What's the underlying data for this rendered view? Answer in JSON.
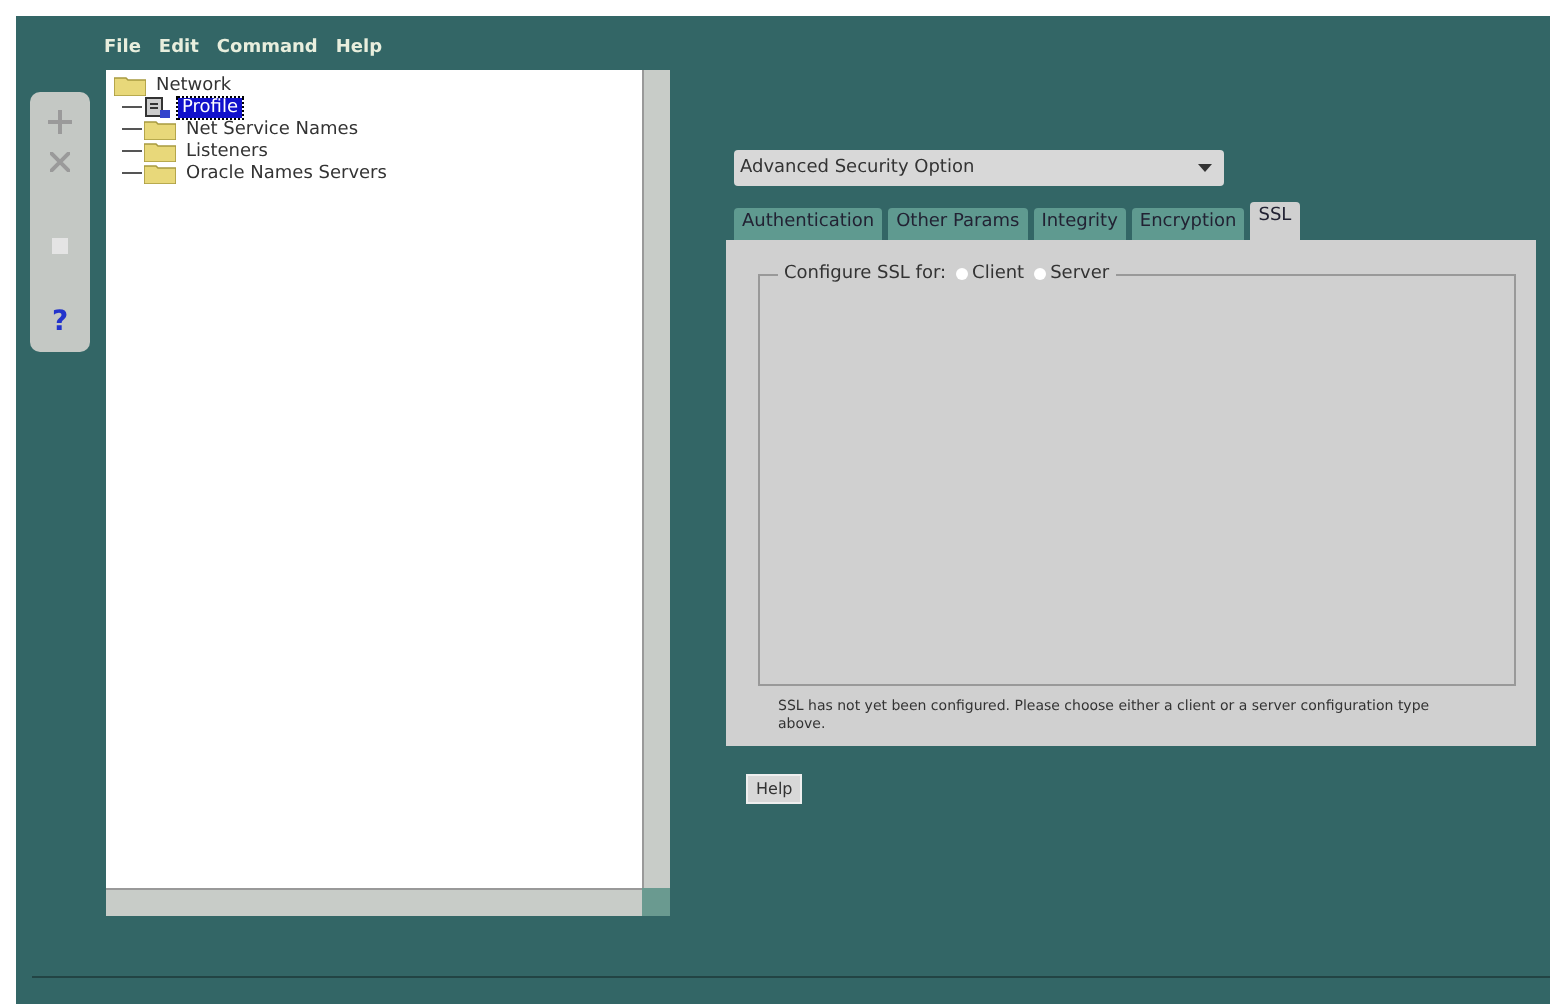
{
  "menu": [
    "File",
    "Edit",
    "Command",
    "Help"
  ],
  "toolbar": [
    {
      "kind": "plus",
      "disabled": true
    },
    {
      "kind": "cross",
      "disabled": true
    },
    {
      "kind": "blank",
      "disabled": true
    },
    {
      "kind": "help",
      "label": "?",
      "disabled": false
    }
  ],
  "tree": [
    {
      "label": "Network",
      "kind": "folder",
      "selected": false,
      "children": [
        {
          "label": "Profile",
          "kind": "profile",
          "selected": true
        },
        {
          "label": "Net Service Names",
          "kind": "folder",
          "selected": false
        },
        {
          "label": "Listeners",
          "kind": "folder",
          "selected": false
        },
        {
          "label": "Oracle Names Servers",
          "kind": "folder",
          "selected": false
        }
      ]
    }
  ],
  "dropdown": {
    "value": "Advanced Security Option"
  },
  "tabs": [
    {
      "label": "Authentication",
      "selected": false
    },
    {
      "label": "Other Params",
      "selected": false
    },
    {
      "label": "Integrity",
      "selected": false
    },
    {
      "label": "Encryption",
      "selected": false
    },
    {
      "label": "SSL",
      "selected": true
    }
  ],
  "group": {
    "title": "Configure SSL for:",
    "options": [
      {
        "label": "Client",
        "selected": false
      },
      {
        "label": "Server",
        "selected": false
      }
    ]
  },
  "message": "SSL has not yet been configured. Please choose either a client or a server configuration type above.",
  "buttons": [
    "Help"
  ]
}
